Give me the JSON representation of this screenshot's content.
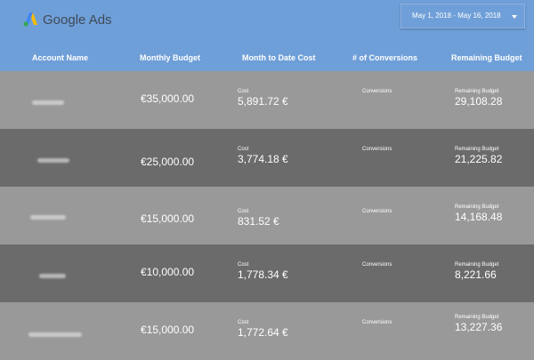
{
  "brand": {
    "name": "Google Ads",
    "icon": "google-ads-logo"
  },
  "date_range": {
    "label": "May 1, 2018 - May 16, 2018"
  },
  "columns": [
    "Account Name",
    "Monthly Budget",
    "Month to Date Cost",
    "# of Conversions",
    "Remaining Budget"
  ],
  "rows": [
    {
      "monthly_budget": "€35,000.00",
      "cost_label": "Cost",
      "cost": "5,891.72 €",
      "conversions_label": "Conversions",
      "remaining_label": "Remaining Budget",
      "remaining": "29,108.28"
    },
    {
      "monthly_budget": "€25,000.00",
      "cost_label": "Cost",
      "cost": "3,774.18 €",
      "conversions_label": "Conversions",
      "remaining_label": "Remaining Budget",
      "remaining": "21,225.82"
    },
    {
      "monthly_budget": "€15,000.00",
      "cost_label": "Cost",
      "cost": "831.52 €",
      "conversions_label": "Conversions",
      "remaining_label": "Remaining Budget",
      "remaining": "14,168.48"
    },
    {
      "monthly_budget": "€10,000.00",
      "cost_label": "Cost",
      "cost": "1,778.34 €",
      "conversions_label": "Conversions",
      "remaining_label": "Remaining Budget",
      "remaining": "8,221.66"
    },
    {
      "monthly_budget": "€15,000.00",
      "cost_label": "Cost",
      "cost": "1,772.64 €",
      "conversions_label": "Conversions",
      "remaining_label": "Remaining Budget",
      "remaining": "13,227.36"
    }
  ],
  "colors": {
    "header_bg": "#6f9fd8",
    "row_light": "#999999",
    "row_dark": "#6b6b6b",
    "text": "#ffffff"
  }
}
